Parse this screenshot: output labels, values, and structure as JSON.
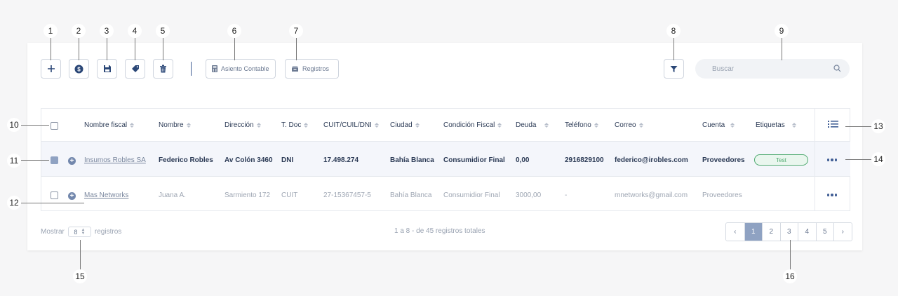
{
  "callouts": [
    "1",
    "2",
    "3",
    "4",
    "5",
    "6",
    "7",
    "8",
    "9",
    "10",
    "11",
    "12",
    "13",
    "14",
    "15",
    "16"
  ],
  "toolbar": {
    "add_icon": "plus-icon",
    "payment_icon": "dollar-coin-icon",
    "save_icon": "floppy-disk-icon",
    "tag_icon": "tag-icon",
    "delete_icon": "trash-icon",
    "asiento_label": "Asiento Contable",
    "registros_label": "Registros",
    "filter_icon": "filter-funnel-icon"
  },
  "search": {
    "placeholder": "Buscar",
    "icon": "search-icon"
  },
  "table": {
    "columns": [
      "Nombre fiscal",
      "Nombre",
      "Dirección",
      "T. Doc",
      "CUIT/CUIL/DNI",
      "Ciudad",
      "Condición Fiscal",
      "Deuda",
      "Teléfono",
      "Correo",
      "Cuenta",
      "Etiquetas"
    ],
    "rows": [
      {
        "selected": true,
        "nombre_fiscal": "Insumos Robles SA",
        "nombre": "Federico Robles",
        "direccion": "Av Colón 3460",
        "tdoc": "DNI",
        "cuit": "17.498.274",
        "ciudad": "Bahía Blanca",
        "condicion": "Consumidior Final",
        "deuda": "0,00",
        "telefono": "2916829100",
        "correo": "federico@irobles.com",
        "cuenta": "Proveedores",
        "etiqueta": "Test"
      },
      {
        "selected": false,
        "nombre_fiscal": "Mas Networks",
        "nombre": "Juana A.",
        "direccion": "Sarmiento 172",
        "tdoc": "CUIT",
        "cuit": "27-15367457-5",
        "ciudad": "Bahía Blanca",
        "condicion": "Consumidior Final",
        "deuda": "3000,00",
        "telefono": "-",
        "correo": "mnetworks@gmail.com",
        "cuenta": "Proveedores",
        "etiqueta": ""
      }
    ]
  },
  "footer": {
    "show_label": "Mostrar",
    "page_size": "8",
    "records_label": "registros",
    "summary": "1 a 8 - de 45 registros totales",
    "pages": [
      "1",
      "2",
      "3",
      "4",
      "5"
    ],
    "current_page": "1",
    "prev": "‹",
    "next": "›"
  },
  "colors": {
    "accent": "#3f5d94",
    "selected_row": "#f4f6fb",
    "tag_green": "#4faa70",
    "active_page": "#8fa2c2"
  }
}
